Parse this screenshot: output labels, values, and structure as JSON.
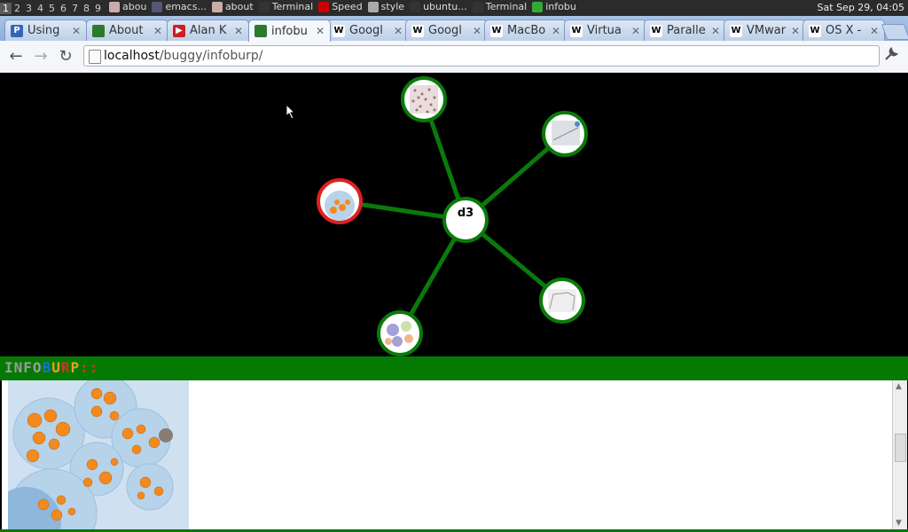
{
  "taskbar": {
    "workspaces": [
      "1",
      "2",
      "3",
      "4",
      "5",
      "6",
      "7",
      "8",
      "9"
    ],
    "tasks": [
      {
        "label": "abou",
        "color": "#caa"
      },
      {
        "label": "emacs...",
        "color": "#557"
      },
      {
        "label": "about",
        "color": "#caa"
      },
      {
        "label": "Terminal",
        "color": "#333"
      },
      {
        "label": "Speed",
        "color": "#c00"
      },
      {
        "label": "style",
        "color": "#aaa"
      },
      {
        "label": "ubuntu...",
        "color": "#333"
      },
      {
        "label": "Terminal",
        "color": "#333"
      },
      {
        "label": "infobu",
        "color": "#3a3"
      }
    ],
    "clock": "Sat Sep 29, 04:05"
  },
  "tabs": [
    {
      "label": "Using",
      "fav": "P",
      "fav_color": "#3466b5"
    },
    {
      "label": "About",
      "fav": "",
      "fav_color": "#2c7a2c"
    },
    {
      "label": "Alan K",
      "fav": "▶",
      "fav_color": "#cc2020"
    },
    {
      "label": "infobu",
      "fav": "",
      "fav_color": "#2c7a2c",
      "active": true
    },
    {
      "label": "Googl",
      "fav": "W",
      "fav_color": "#ffffff"
    },
    {
      "label": "Googl",
      "fav": "W",
      "fav_color": "#ffffff"
    },
    {
      "label": "MacBo",
      "fav": "W",
      "fav_color": "#ffffff"
    },
    {
      "label": "Virtua",
      "fav": "W",
      "fav_color": "#ffffff"
    },
    {
      "label": "Paralle",
      "fav": "W",
      "fav_color": "#ffffff"
    },
    {
      "label": "VMwar",
      "fav": "W",
      "fav_color": "#ffffff"
    },
    {
      "label": "OS X -",
      "fav": "W",
      "fav_color": "#ffffff"
    }
  ],
  "address": {
    "host": "localhost",
    "path": "/buggy/infoburp/"
  },
  "graph": {
    "center_label": "d3",
    "edge_color": "#0a7a0a",
    "node_ring_color": "#0a7a0a",
    "selected_ring_color": "#e02020"
  },
  "logo_letters": [
    {
      "ch": "I",
      "color": "#9a9a9a"
    },
    {
      "ch": "N",
      "color": "#9a9a9a"
    },
    {
      "ch": "F",
      "color": "#9a9a9a"
    },
    {
      "ch": "O",
      "color": "#9a9a9a"
    },
    {
      "ch": "B",
      "color": "#1a6fd0"
    },
    {
      "ch": "U",
      "color": "#e8a020"
    },
    {
      "ch": "R",
      "color": "#d83020"
    },
    {
      "ch": "P",
      "color": "#e8a020"
    },
    {
      "ch": "::",
      "color": "#d83020"
    }
  ],
  "colors": {
    "banner": "#047a04",
    "bubble_outer": "#b7d3ea",
    "bubble_node": "#f28a1e"
  }
}
